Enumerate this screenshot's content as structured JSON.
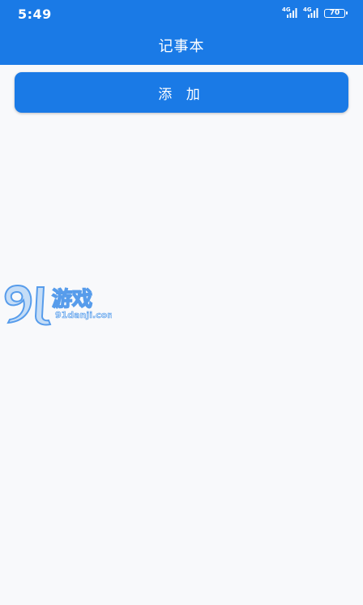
{
  "status_bar": {
    "time": "5:49",
    "network1": "4G",
    "network2": "4G",
    "battery": "70"
  },
  "header": {
    "title": "记事本"
  },
  "actions": {
    "add_label": "添 加"
  },
  "watermark": {
    "logo_text": "91游戏",
    "site": "91danji.com"
  },
  "colors": {
    "primary": "#1a7ae6",
    "background": "#f8f9fb"
  }
}
